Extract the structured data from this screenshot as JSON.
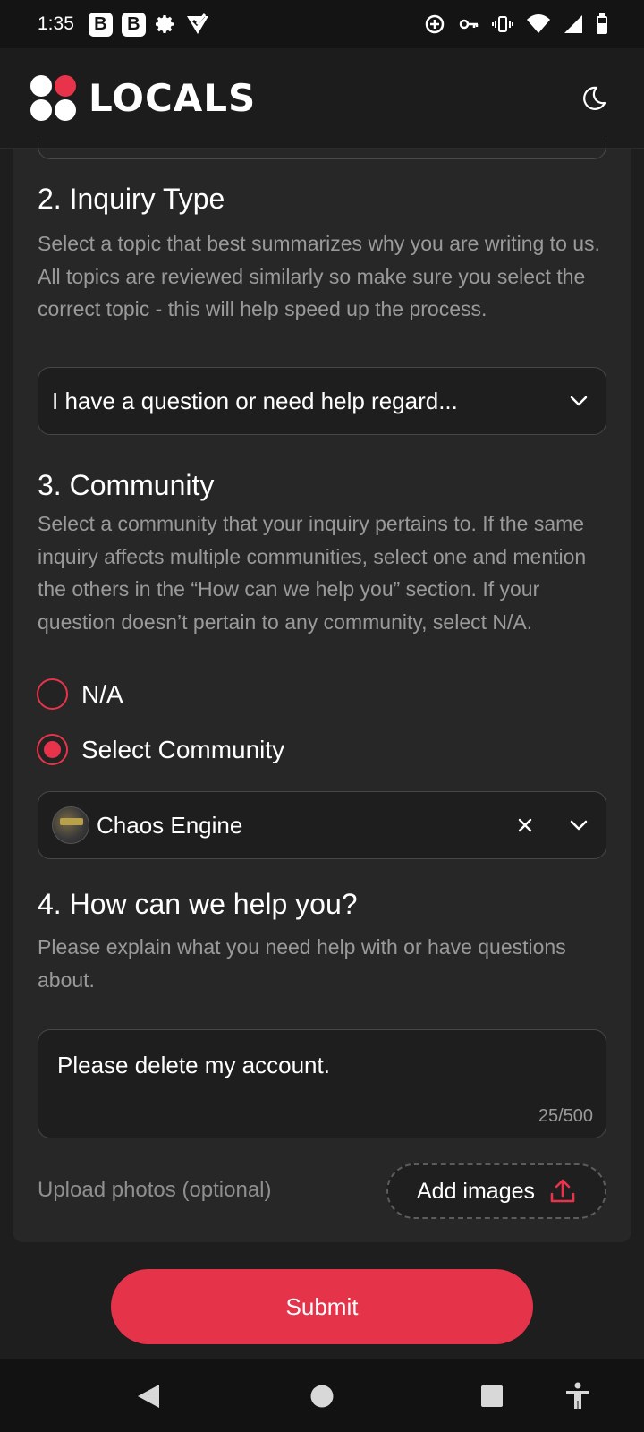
{
  "status_bar": {
    "time": "1:35",
    "badge_1": "B",
    "badge_2": "B",
    "left_icons": [
      "b-badge",
      "b-badge",
      "gear-icon",
      "check-shield-icon"
    ],
    "right_icons": [
      "data-saver-icon",
      "vpn-key-icon",
      "vibrate-icon",
      "wifi-icon",
      "signal-icon",
      "battery-icon"
    ]
  },
  "header": {
    "logo_text": "LOCALS",
    "brand_color": "#e8334a",
    "theme_toggle_icon": "moon-icon"
  },
  "form": {
    "inquiry_type": {
      "title": "2. Inquiry Type",
      "description": "Select a topic that best summarizes why you are writing to us. All topics are reviewed similarly so make sure you select the correct topic - this will help speed up the process.",
      "selected_value": "I have a question or need help regard..."
    },
    "community": {
      "title": "3. Community",
      "description": "Select a community that your inquiry pertains to. If the same inquiry affects multiple communities, select one and mention the others in the “How can we help you” section. If your question doesn’t pertain to any community, select N/A.",
      "options": [
        {
          "label": "N/A",
          "selected": false
        },
        {
          "label": "Select Community",
          "selected": true
        }
      ],
      "selected_community": "Chaos Engine"
    },
    "help": {
      "title": "4. How can we help you?",
      "description": "Please explain what you need help with or have questions about.",
      "message": "Please delete my account.",
      "char_count": "25/500"
    },
    "upload": {
      "label": "Upload photos (optional)",
      "button_label": "Add images",
      "button_icon": "upload-icon"
    }
  },
  "submit_label": "Submit",
  "nav_bar": {
    "buttons": [
      "back-icon",
      "home-icon",
      "recents-icon",
      "accessibility-icon"
    ]
  }
}
